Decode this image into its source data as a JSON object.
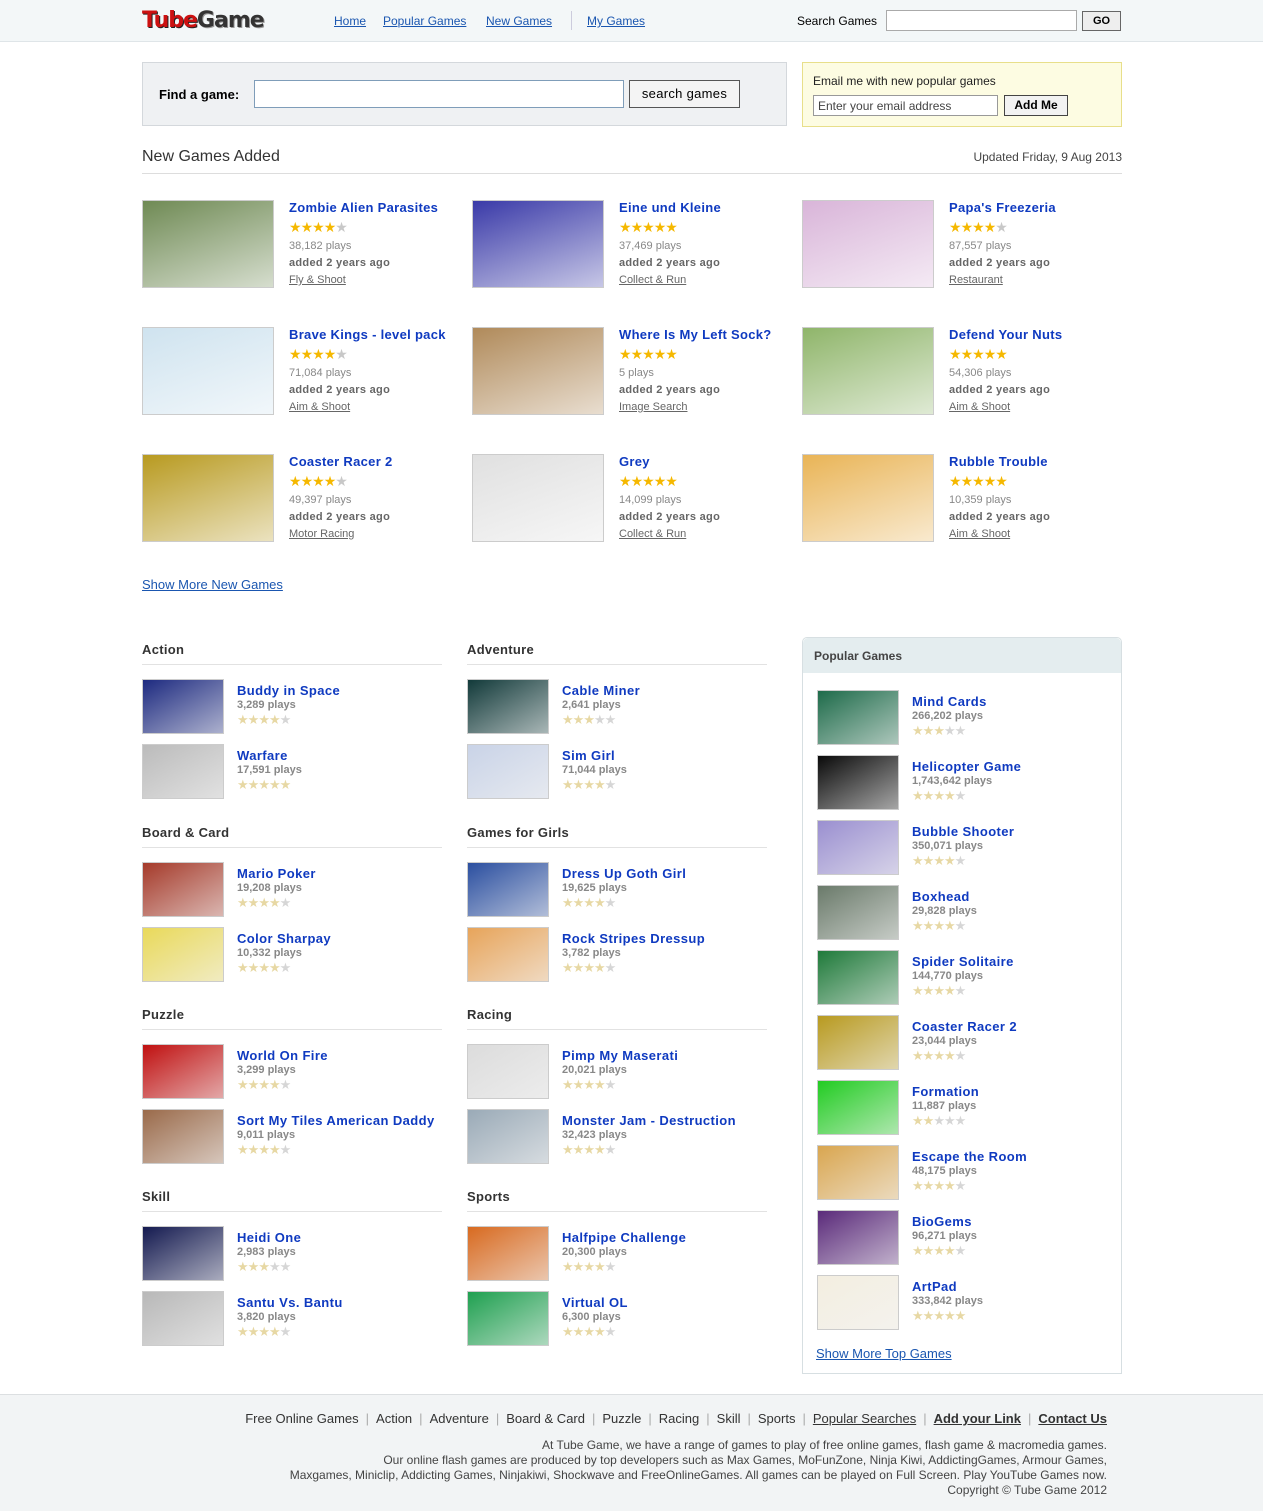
{
  "header": {
    "logo_part1": "Tube",
    "logo_part2": "Game",
    "nav": [
      "Home",
      "Popular Games",
      "New Games",
      "My Games"
    ],
    "search_label": "Search Games",
    "search_value": "",
    "go_label": "GO"
  },
  "find": {
    "label": "Find a game:",
    "value": "",
    "button": "search games"
  },
  "email": {
    "label": "Email me with new popular games",
    "placeholder": "Enter your email address",
    "button": "Add Me"
  },
  "new_games": {
    "title": "New Games Added",
    "updated": "Updated Friday, 9 Aug 2013",
    "more": "Show More New Games",
    "items": [
      {
        "name": "Zombie Alien Parasites",
        "rating": 4,
        "plays": "38,182 plays",
        "added": "added 2 years ago",
        "category": "Fly & Shoot",
        "thumb": "#6f8a54"
      },
      {
        "name": "Eine und Kleine",
        "rating": 5,
        "plays": "37,469 plays",
        "added": "added 2 years ago",
        "category": "Collect & Run",
        "thumb": "#3a3aa8"
      },
      {
        "name": "Papa's Freezeria",
        "rating": 4,
        "plays": "87,557 plays",
        "added": "added 2 years ago",
        "category": "Restaurant",
        "thumb": "#d9b5d9"
      },
      {
        "name": "Brave Kings - level pack",
        "rating": 4,
        "plays": "71,084 plays",
        "added": "added 2 years ago",
        "category": "Aim & Shoot",
        "thumb": "#cfe3ef"
      },
      {
        "name": "Where Is My Left Sock?",
        "rating": 5,
        "plays": "5 plays",
        "added": "added 2 years ago",
        "category": "Image Search",
        "thumb": "#b08a5a"
      },
      {
        "name": "Defend Your Nuts",
        "rating": 5,
        "plays": "54,306 plays",
        "added": "added 2 years ago",
        "category": "Aim & Shoot",
        "thumb": "#8fb56a"
      },
      {
        "name": "Coaster Racer 2",
        "rating": 4,
        "plays": "49,397 plays",
        "added": "added 2 years ago",
        "category": "Motor Racing",
        "thumb": "#b89a20"
      },
      {
        "name": "Grey",
        "rating": 5,
        "plays": "14,099 plays",
        "added": "added 2 years ago",
        "category": "Collect & Run",
        "thumb": "#e0e0e0"
      },
      {
        "name": "Rubble Trouble",
        "rating": 5,
        "plays": "10,359 plays",
        "added": "added 2 years ago",
        "category": "Aim & Shoot",
        "thumb": "#e9b456"
      }
    ]
  },
  "categories": [
    {
      "title": "Action",
      "games": [
        {
          "name": "Buddy in Space",
          "plays": "3,289 plays",
          "rating": 4,
          "thumb": "#1d2a80"
        },
        {
          "name": "Warfare",
          "plays": "17,591 plays",
          "rating": 5,
          "thumb": "#bbbbbb"
        }
      ]
    },
    {
      "title": "Adventure",
      "games": [
        {
          "name": "Cable Miner",
          "plays": "2,641 plays",
          "rating": 3,
          "thumb": "#123a3a"
        },
        {
          "name": "Sim Girl",
          "plays": "71,044 plays",
          "rating": 4,
          "thumb": "#c9d3e7"
        }
      ]
    },
    {
      "title": "Board & Card",
      "games": [
        {
          "name": "Mario Poker",
          "plays": "19,208 plays",
          "rating": 4,
          "thumb": "#a53a2a"
        },
        {
          "name": "Color Sharpay",
          "plays": "10,332 plays",
          "rating": 4,
          "thumb": "#e9d95a"
        }
      ]
    },
    {
      "title": "Games for Girls",
      "games": [
        {
          "name": "Dress Up Goth Girl",
          "plays": "19,625 plays",
          "rating": 4,
          "thumb": "#2b4fa0"
        },
        {
          "name": "Rock Stripes Dressup",
          "plays": "3,782 plays",
          "rating": 4,
          "thumb": "#e7a45a"
        }
      ]
    },
    {
      "title": "Puzzle",
      "games": [
        {
          "name": "World On Fire",
          "plays": "3,299 plays",
          "rating": 4,
          "thumb": "#c01010"
        },
        {
          "name": "Sort My Tiles American Daddy",
          "plays": "9,011 plays",
          "rating": 4,
          "thumb": "#9a6a4a"
        }
      ]
    },
    {
      "title": "Racing",
      "games": [
        {
          "name": "Pimp My Maserati",
          "plays": "20,021 plays",
          "rating": 4,
          "thumb": "#dcdcdc"
        },
        {
          "name": "Monster Jam - Destruction",
          "plays": "32,423 plays",
          "rating": 4,
          "thumb": "#9aaab7"
        }
      ]
    },
    {
      "title": "Skill",
      "games": [
        {
          "name": "Heidi One",
          "plays": "2,983 plays",
          "rating": 3,
          "thumb": "#141a50"
        },
        {
          "name": "Santu Vs. Bantu",
          "plays": "3,820 plays",
          "rating": 4,
          "thumb": "#b8b8b8"
        }
      ]
    },
    {
      "title": "Sports",
      "games": [
        {
          "name": "Halfpipe Challenge",
          "plays": "20,300 plays",
          "rating": 4,
          "thumb": "#d86a20"
        },
        {
          "name": "Virtual OL",
          "plays": "6,300 plays",
          "rating": 4,
          "thumb": "#1fa050"
        }
      ]
    }
  ],
  "popular": {
    "title": "Popular Games",
    "more": "Show More Top Games",
    "games": [
      {
        "name": "Mind Cards",
        "plays": "266,202 plays",
        "rating": 3,
        "thumb": "#1e6b4a"
      },
      {
        "name": "Helicopter Game",
        "plays": "1,743,642 plays",
        "rating": 4,
        "thumb": "#0a0a0a"
      },
      {
        "name": "Bubble Shooter",
        "plays": "350,071 plays",
        "rating": 4,
        "thumb": "#9a8fd0"
      },
      {
        "name": "Boxhead",
        "plays": "29,828 plays",
        "rating": 4,
        "thumb": "#6a7a6a"
      },
      {
        "name": "Spider Solitaire",
        "plays": "144,770 plays",
        "rating": 4,
        "thumb": "#1f7a3a"
      },
      {
        "name": "Coaster Racer 2",
        "plays": "23,044 plays",
        "rating": 4,
        "thumb": "#b89a20"
      },
      {
        "name": "Formation",
        "plays": "11,887 plays",
        "rating": 2,
        "thumb": "#22cc22"
      },
      {
        "name": "Escape the Room",
        "plays": "48,175 plays",
        "rating": 4,
        "thumb": "#d9a650"
      },
      {
        "name": "BioGems",
        "plays": "96,271 plays",
        "rating": 4,
        "thumb": "#5a2a7a"
      },
      {
        "name": "ArtPad",
        "plays": "333,842 plays",
        "rating": 5,
        "thumb": "#f3eee0"
      }
    ]
  },
  "footer": {
    "links": [
      "Free Online Games",
      "Action",
      "Adventure",
      "Board & Card",
      "Puzzle",
      "Racing",
      "Skill",
      "Sports",
      "Popular Searches",
      "Add your Link",
      "Contact Us"
    ],
    "lines": [
      "At Tube Game, we have a range of games to play of free online games, flash game & macromedia games.",
      "Our online flash games are produced by top developers such as Max Games, MoFunZone, Ninja Kiwi, AddictingGames, Armour Games,",
      "Maxgames, Miniclip, Addicting Games, Ninjakiwi, Shockwave and FreeOnlineGames. All games can be played on Full Screen. Play YouTube Games now.",
      "Copyright © Tube Game 2012"
    ]
  }
}
